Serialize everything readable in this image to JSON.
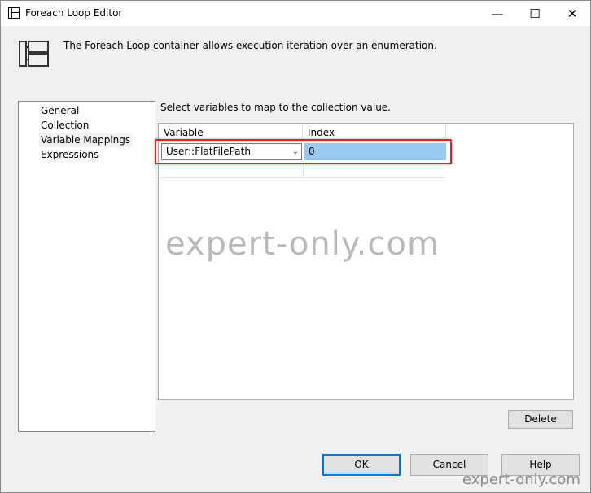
{
  "window": {
    "title": "Foreach Loop Editor",
    "controls": {
      "minimize": "—",
      "maximize": "☐",
      "close": "✕"
    }
  },
  "header": {
    "description": "The Foreach Loop container allows execution iteration over an enumeration."
  },
  "nav": {
    "items": [
      {
        "label": "General"
      },
      {
        "label": "Collection"
      },
      {
        "label": "Variable Mappings"
      },
      {
        "label": "Expressions"
      }
    ],
    "selected": "Variable Mappings"
  },
  "mappings": {
    "instruction": "Select variables to map to the collection value.",
    "columns": [
      "Variable",
      "Index"
    ],
    "rows": [
      {
        "variable": "User::FlatFilePath",
        "index": "0"
      }
    ]
  },
  "buttons": {
    "delete": "Delete",
    "ok": "OK",
    "cancel": "Cancel",
    "help": "Help"
  },
  "watermark": {
    "main": "expert-only.com",
    "corner": "expert-only.com"
  },
  "colors": {
    "selection": "#99c9ef",
    "highlight_border": "#d2262b",
    "default_button_border": "#0078d7"
  }
}
